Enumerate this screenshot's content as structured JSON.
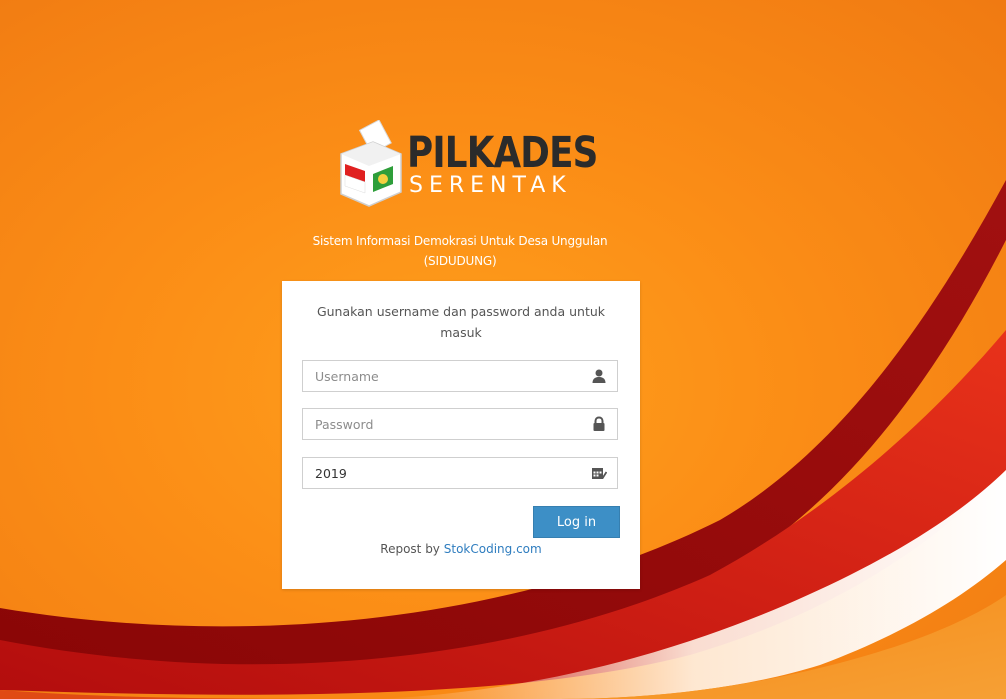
{
  "logo": {
    "word1": "PILKADES",
    "word2": "SERENTAK",
    "colors": {
      "dark": "#2b2b2b",
      "red": "#e02020",
      "green": "#2e9e3a"
    }
  },
  "subtitle": {
    "line1": "Sistem Informasi Demokrasi Untuk Desa Unggulan",
    "line2": "(SIDUDUNG)"
  },
  "login": {
    "message_line1": "Gunakan username dan password anda untuk",
    "message_line2": "masuk",
    "username": {
      "placeholder": "Username",
      "value": "",
      "icon": "user-icon"
    },
    "password": {
      "placeholder": "Password",
      "value": "",
      "icon": "lock-icon"
    },
    "year": {
      "value": "2019",
      "icon": "calendar-check-icon"
    },
    "button_label": "Log in",
    "footer_prefix": "Repost by",
    "footer_link": "StokCoding.com"
  },
  "colors": {
    "background": "#fb8d16",
    "button": "#3d8fc6",
    "link": "#2f7dbf"
  }
}
